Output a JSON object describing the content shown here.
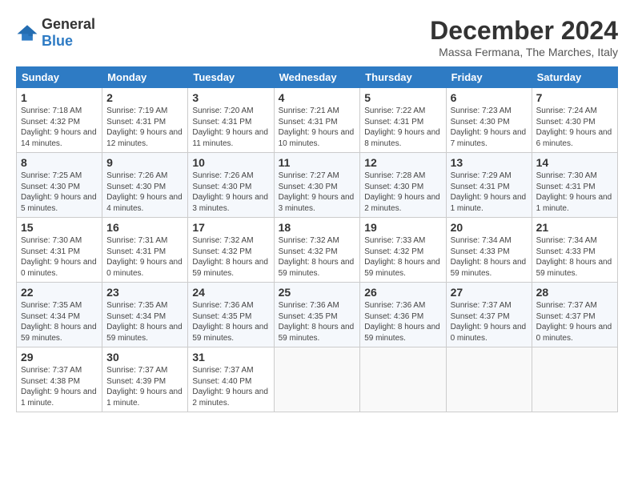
{
  "header": {
    "logo_general": "General",
    "logo_blue": "Blue",
    "title": "December 2024",
    "subtitle": "Massa Fermana, The Marches, Italy"
  },
  "calendar": {
    "days_of_week": [
      "Sunday",
      "Monday",
      "Tuesday",
      "Wednesday",
      "Thursday",
      "Friday",
      "Saturday"
    ],
    "weeks": [
      [
        null,
        null,
        null,
        null,
        null,
        null,
        null
      ]
    ],
    "cells": [
      [
        {
          "day": 1,
          "sunrise": "7:18 AM",
          "sunset": "4:32 PM",
          "daylight": "9 hours and 14 minutes."
        },
        {
          "day": 2,
          "sunrise": "7:19 AM",
          "sunset": "4:31 PM",
          "daylight": "9 hours and 12 minutes."
        },
        {
          "day": 3,
          "sunrise": "7:20 AM",
          "sunset": "4:31 PM",
          "daylight": "9 hours and 11 minutes."
        },
        {
          "day": 4,
          "sunrise": "7:21 AM",
          "sunset": "4:31 PM",
          "daylight": "9 hours and 10 minutes."
        },
        {
          "day": 5,
          "sunrise": "7:22 AM",
          "sunset": "4:31 PM",
          "daylight": "9 hours and 8 minutes."
        },
        {
          "day": 6,
          "sunrise": "7:23 AM",
          "sunset": "4:30 PM",
          "daylight": "9 hours and 7 minutes."
        },
        {
          "day": 7,
          "sunrise": "7:24 AM",
          "sunset": "4:30 PM",
          "daylight": "9 hours and 6 minutes."
        }
      ],
      [
        {
          "day": 8,
          "sunrise": "7:25 AM",
          "sunset": "4:30 PM",
          "daylight": "9 hours and 5 minutes."
        },
        {
          "day": 9,
          "sunrise": "7:26 AM",
          "sunset": "4:30 PM",
          "daylight": "9 hours and 4 minutes."
        },
        {
          "day": 10,
          "sunrise": "7:26 AM",
          "sunset": "4:30 PM",
          "daylight": "9 hours and 3 minutes."
        },
        {
          "day": 11,
          "sunrise": "7:27 AM",
          "sunset": "4:30 PM",
          "daylight": "9 hours and 3 minutes."
        },
        {
          "day": 12,
          "sunrise": "7:28 AM",
          "sunset": "4:30 PM",
          "daylight": "9 hours and 2 minutes."
        },
        {
          "day": 13,
          "sunrise": "7:29 AM",
          "sunset": "4:31 PM",
          "daylight": "9 hours and 1 minute."
        },
        {
          "day": 14,
          "sunrise": "7:30 AM",
          "sunset": "4:31 PM",
          "daylight": "9 hours and 1 minute."
        }
      ],
      [
        {
          "day": 15,
          "sunrise": "7:30 AM",
          "sunset": "4:31 PM",
          "daylight": "9 hours and 0 minutes."
        },
        {
          "day": 16,
          "sunrise": "7:31 AM",
          "sunset": "4:31 PM",
          "daylight": "9 hours and 0 minutes."
        },
        {
          "day": 17,
          "sunrise": "7:32 AM",
          "sunset": "4:32 PM",
          "daylight": "8 hours and 59 minutes."
        },
        {
          "day": 18,
          "sunrise": "7:32 AM",
          "sunset": "4:32 PM",
          "daylight": "8 hours and 59 minutes."
        },
        {
          "day": 19,
          "sunrise": "7:33 AM",
          "sunset": "4:32 PM",
          "daylight": "8 hours and 59 minutes."
        },
        {
          "day": 20,
          "sunrise": "7:34 AM",
          "sunset": "4:33 PM",
          "daylight": "8 hours and 59 minutes."
        },
        {
          "day": 21,
          "sunrise": "7:34 AM",
          "sunset": "4:33 PM",
          "daylight": "8 hours and 59 minutes."
        }
      ],
      [
        {
          "day": 22,
          "sunrise": "7:35 AM",
          "sunset": "4:34 PM",
          "daylight": "8 hours and 59 minutes."
        },
        {
          "day": 23,
          "sunrise": "7:35 AM",
          "sunset": "4:34 PM",
          "daylight": "8 hours and 59 minutes."
        },
        {
          "day": 24,
          "sunrise": "7:36 AM",
          "sunset": "4:35 PM",
          "daylight": "8 hours and 59 minutes."
        },
        {
          "day": 25,
          "sunrise": "7:36 AM",
          "sunset": "4:35 PM",
          "daylight": "8 hours and 59 minutes."
        },
        {
          "day": 26,
          "sunrise": "7:36 AM",
          "sunset": "4:36 PM",
          "daylight": "8 hours and 59 minutes."
        },
        {
          "day": 27,
          "sunrise": "7:37 AM",
          "sunset": "4:37 PM",
          "daylight": "9 hours and 0 minutes."
        },
        {
          "day": 28,
          "sunrise": "7:37 AM",
          "sunset": "4:37 PM",
          "daylight": "9 hours and 0 minutes."
        }
      ],
      [
        {
          "day": 29,
          "sunrise": "7:37 AM",
          "sunset": "4:38 PM",
          "daylight": "9 hours and 1 minute."
        },
        {
          "day": 30,
          "sunrise": "7:37 AM",
          "sunset": "4:39 PM",
          "daylight": "9 hours and 1 minute."
        },
        {
          "day": 31,
          "sunrise": "7:37 AM",
          "sunset": "4:40 PM",
          "daylight": "9 hours and 2 minutes."
        },
        null,
        null,
        null,
        null
      ]
    ]
  }
}
